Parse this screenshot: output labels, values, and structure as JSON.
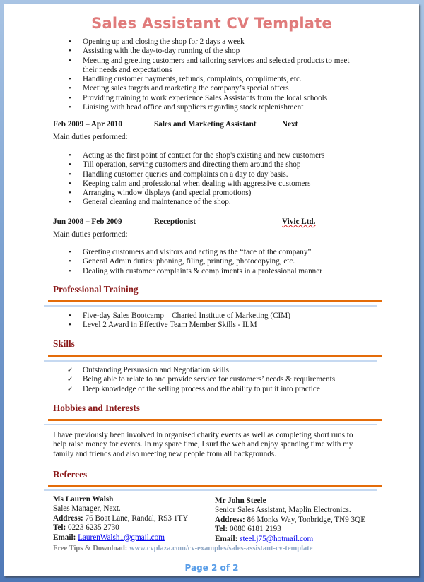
{
  "title": "Sales Assistant CV Template",
  "top_duties": [
    "Opening up and closing the shop for 2 days a week",
    "Assisting with the day-to-day running of the shop",
    "Meeting and greeting customers and tailoring services and selected products to meet",
    "their needs and expectations",
    "Handling customer payments, refunds, complaints, compliments, etc.",
    "Meeting sales targets and marketing the company’s special offers",
    "Providing training to work experience Sales Assistants from the local schools",
    "Liaising with head office and suppliers regarding stock replenishment"
  ],
  "jobs": [
    {
      "dates": "Feb 2009 – Apr 2010",
      "role": "Sales and Marketing Assistant",
      "company": "Next",
      "duties_label": "Main duties performed:",
      "duties": [
        "Acting as the first point of contact for the shop's existing and new customers",
        "Till operation, serving customers and directing them around the shop",
        "Handling customer queries and complaints on a day to day basis.",
        "Keeping calm and professional when dealing with aggressive customers",
        "Arranging window displays (and special promotions)",
        "General cleaning and maintenance of the shop."
      ]
    },
    {
      "dates": "Jun 2008 – Feb 2009",
      "role": "Receptionist",
      "company": "Vivic Ltd.",
      "duties_label": "Main duties performed:",
      "duties": [
        "Greeting customers and visitors and acting as the “face of the company”",
        "General Admin duties: phoning, filing, printing, photocopying, etc.",
        "Dealing with customer complaints & compliments in a professional manner"
      ]
    }
  ],
  "sections": {
    "training": {
      "title": "Professional Training",
      "items": [
        "Five-day Sales Bootcamp – Charted Institute of Marketing (CIM)",
        "Level 2 Award in Effective Team Member Skills - ILM"
      ]
    },
    "skills": {
      "title": "Skills",
      "items": [
        "Outstanding Persuasion and Negotiation skills",
        "Being able to relate to and provide service for customers’ needs & requirements",
        "Deep knowledge of the selling process and the ability to put it into practice"
      ]
    },
    "hobbies": {
      "title": "Hobbies and Interests",
      "lines": [
        "I have previously been involved in organised charity events as well as completing short runs to",
        "help raise money for events. In my spare time, I surf the web and enjoy spending time with my",
        "family and friends and also meeting new people from all backgrounds."
      ]
    },
    "referees": {
      "title": "Referees",
      "people": [
        {
          "name": "Ms Lauren Walsh",
          "position": "Sales Manager, Next.",
          "address_label": "Address:",
          "address": "76 Boat Lane, Randal, RS3 1TY",
          "tel_label": "Tel:",
          "tel": "0223 6235 2730",
          "email_label": "Email:",
          "email": "LaurenWalsh1@gmail.com"
        },
        {
          "name": "Mr John Steele",
          "position": "Senior Sales Assistant, Maplin Electronics.",
          "address_label": "Address:",
          "address": "86 Monks Way, Tonbridge, TN9 3QE",
          "tel_label": "Tel:",
          "tel": "0080 6181 2193",
          "email_label": "Email:",
          "email": "steel.j75@hotmail.com"
        }
      ]
    }
  },
  "footer": {
    "tip_label": "Free Tips & Download:",
    "tip_url": "www.cvplaza.com/cv-examples/sales-assistant-cv-template",
    "page": "Page 2 of 2"
  },
  "colors": {
    "title": "#e07b7b",
    "section_heading": "#8b1a1a",
    "rule_orange": "#e46c0a",
    "rule_blue": "#c6d9f1",
    "page_number": "#5a9ee8"
  }
}
